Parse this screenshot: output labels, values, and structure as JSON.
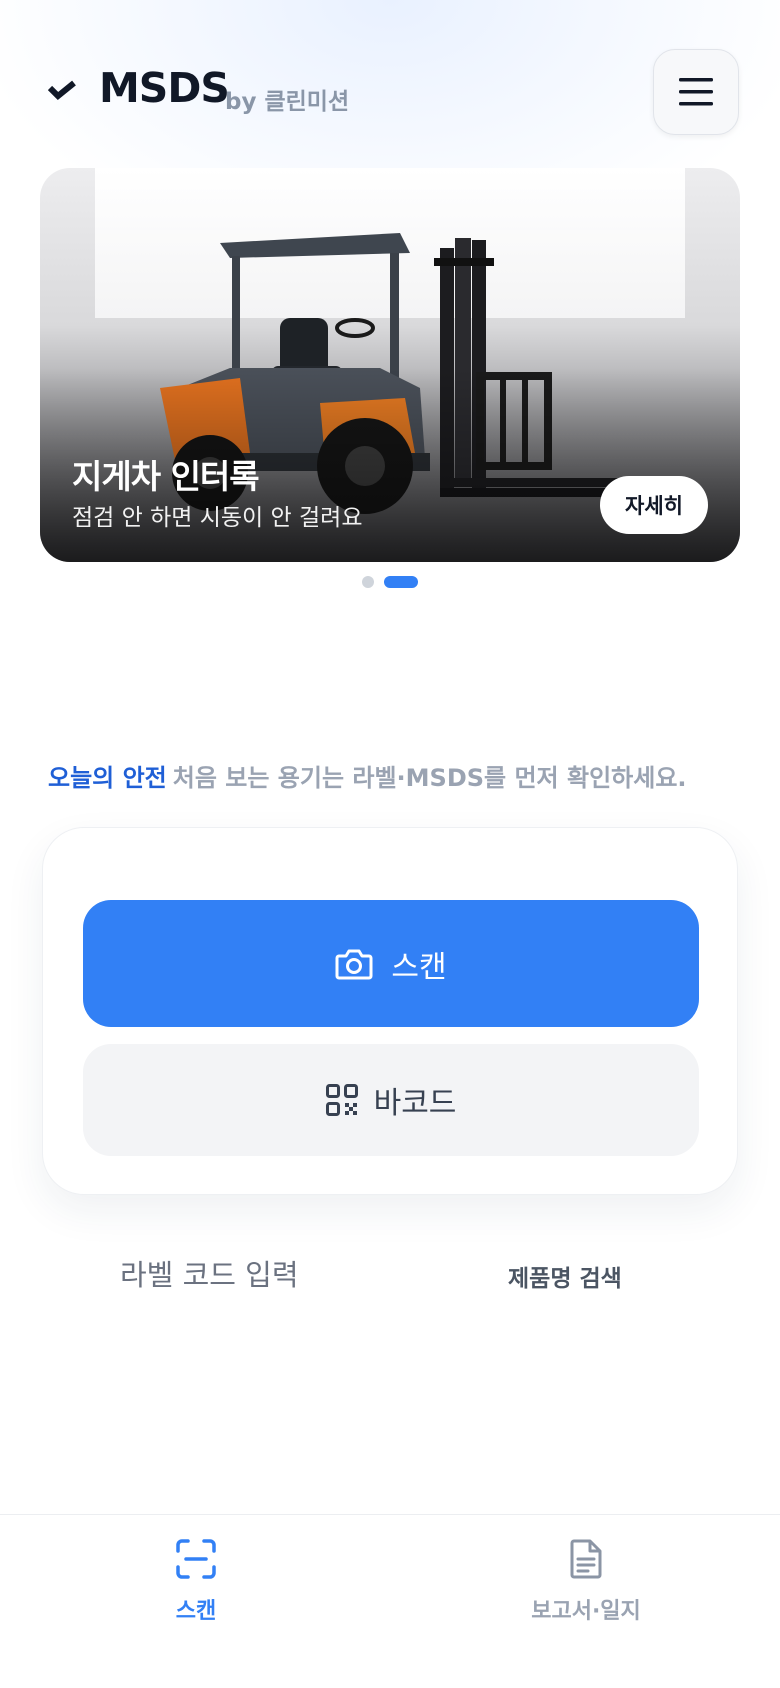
{
  "header": {
    "title": "MSDS",
    "subtitle": "by 클린미션",
    "icons": {
      "logo": "check-mark-logo",
      "menu": "hamburger-menu-icon"
    }
  },
  "banner": {
    "title": "지게차 인터록",
    "subtitle": "점검 안 하면 시동이 안 걸려요",
    "button_label": "자세히",
    "image": "forklift-photo",
    "slide_count": 2,
    "active_slide": 2
  },
  "tip": {
    "label": "오늘의 안전",
    "text": "처음 보는 용기는 라벨·MSDS를 먼저 확인하세요."
  },
  "actions": {
    "scan_label": "스캔",
    "scan_icon": "camera-icon",
    "barcode_label": "바코드",
    "barcode_icon": "qr-code-icon"
  },
  "links": {
    "code_input": "라벨 코드 입력",
    "product_search": "제품명 검색"
  },
  "bottom_nav": {
    "items": [
      {
        "label": "스캔",
        "icon": "scan-frame-icon",
        "active": true
      },
      {
        "label": "보고서·일지",
        "icon": "document-icon",
        "active": false
      }
    ]
  },
  "colors": {
    "accent": "#3280f5",
    "tip_label": "#1f5fd6",
    "muted": "#9aa3b2"
  }
}
